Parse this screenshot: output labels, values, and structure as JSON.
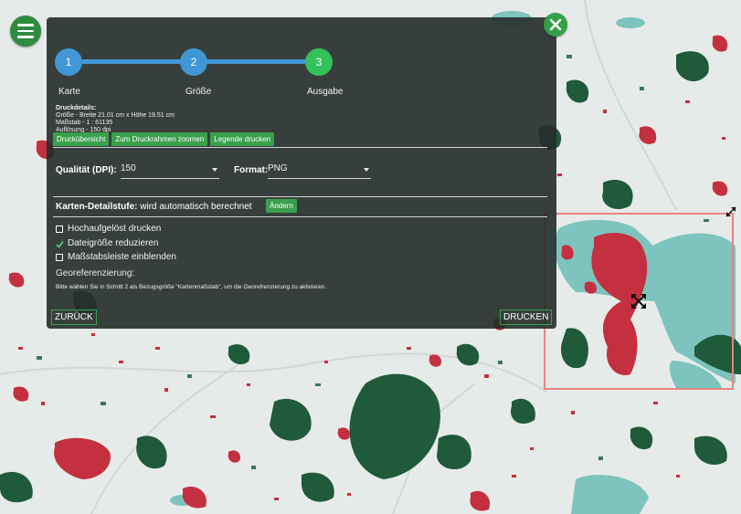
{
  "steps": [
    {
      "number": "1",
      "label": "Karte"
    },
    {
      "number": "2",
      "label": "Größe"
    },
    {
      "number": "3",
      "label": "Ausgabe"
    }
  ],
  "details": {
    "heading": "Druckdetails:",
    "size": "Größe - Breite 21.01 cm x Höhe 19.51 cm",
    "scale": "Maßstab - 1 : 61135",
    "resolution": "Auflösung - 150 dpi"
  },
  "buttons": {
    "overview": "Druckübersicht",
    "zoom": "Zum Druckrahmen zoomen",
    "legend": "Legende drucken",
    "change": "Ändern",
    "back": "ZURÜCK",
    "print": "DRUCKEN"
  },
  "quality": {
    "label": "Qualität (DPI):",
    "value": "150"
  },
  "format": {
    "label": "Format:",
    "value": "PNG"
  },
  "detail_level": {
    "label": "Karten-Detailstufe:",
    "value": "wird automatisch berechnet"
  },
  "options": [
    {
      "label": "Hochaufgelöst drucken",
      "checked": false
    },
    {
      "label": "Dateigröße reduzieren",
      "checked": true
    },
    {
      "label": "Maßstabsleiste einblenden",
      "checked": false
    }
  ],
  "georef": {
    "label": "Georeferenzierung:",
    "hint": "Bitte wählen Sie in Schritt 2 als Bezugsgröße \"Kartenmaßstab\", um die Georefrenzierung zu aktivieren."
  },
  "colors": {
    "accent_green": "#3aa04b",
    "step_blue": "#3f97d6",
    "step_active": "#33c25a",
    "frame": "#e8847f",
    "forest": "#1f5a3a",
    "urban": "#c4303f",
    "water": "#7cc4bd"
  }
}
